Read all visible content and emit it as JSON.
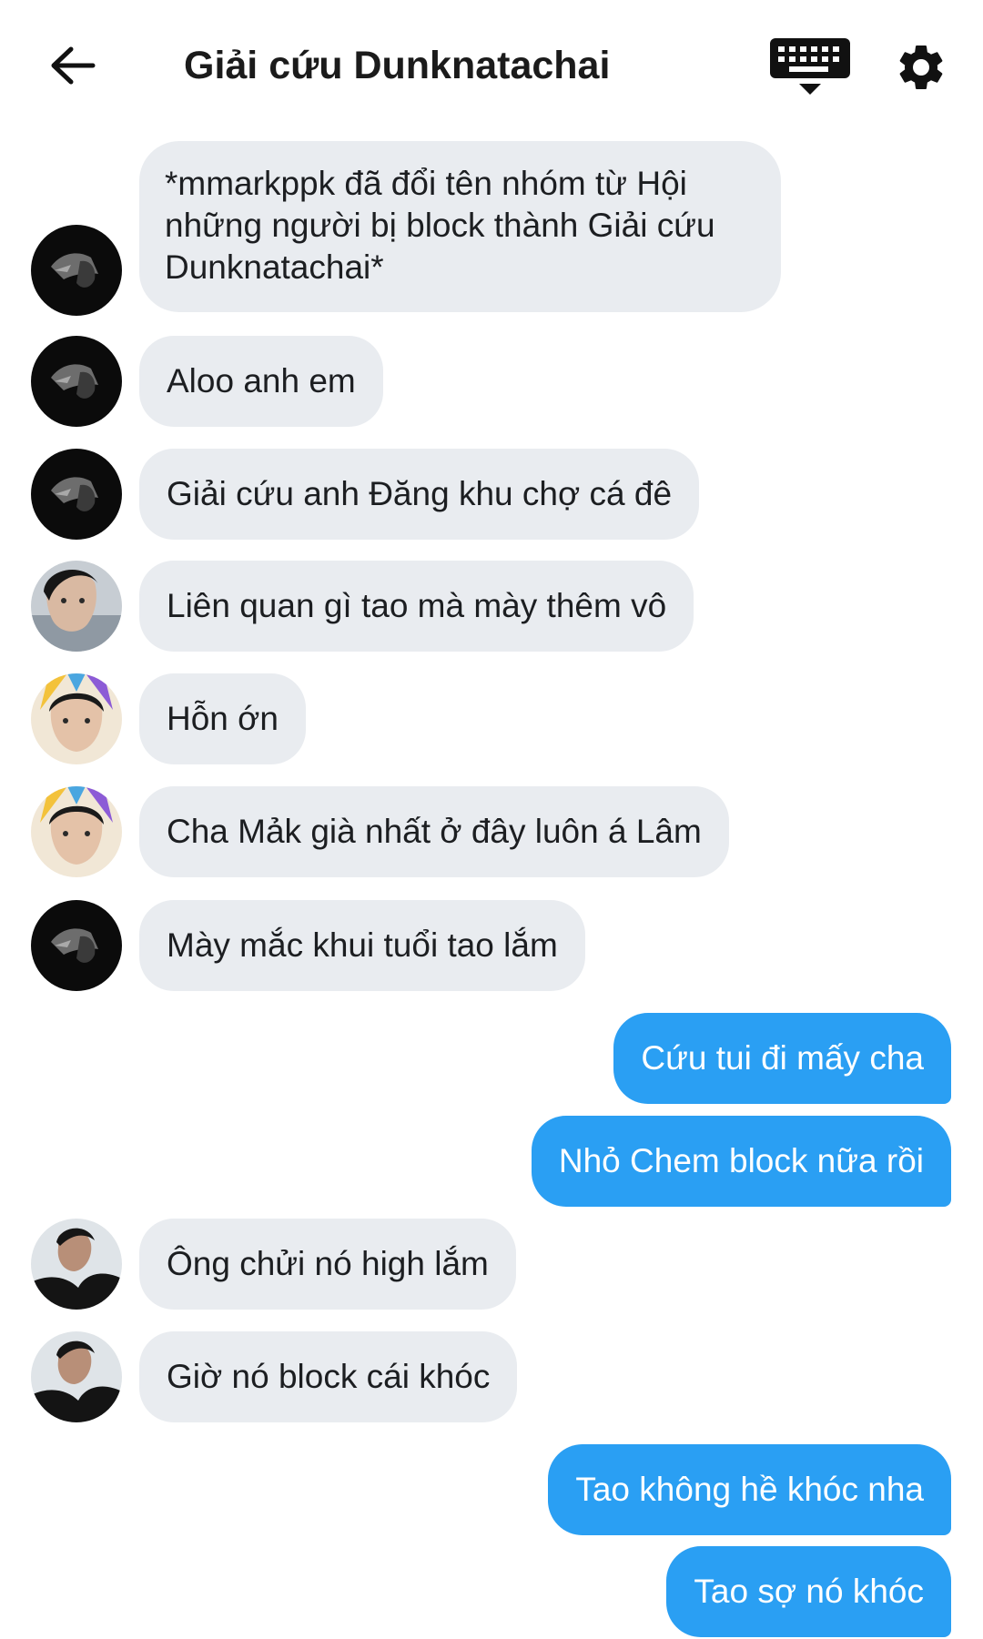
{
  "header": {
    "title": "Giải cứu Dunknatachai",
    "back_icon": "arrow-left-icon",
    "keyboard_icon": "keyboard-icon",
    "settings_icon": "gear-icon"
  },
  "messages": [
    {
      "direction": "in",
      "sender": "user-a",
      "text": "*mmarkppk đã đổi tên nhóm từ Hội những người bị block thành Giải cứu Dunknatachai*"
    },
    {
      "direction": "in",
      "sender": "user-a",
      "text": "Aloo anh em"
    },
    {
      "direction": "in",
      "sender": "user-a",
      "text": "Giải cứu anh Đăng khu chợ cá đê"
    },
    {
      "direction": "in",
      "sender": "user-b",
      "text": "Liên quan gì tao mà mày thêm vô"
    },
    {
      "direction": "in",
      "sender": "user-c",
      "text": "Hỗn ớn"
    },
    {
      "direction": "in",
      "sender": "user-c",
      "text": "Cha Mảk già nhất ở đây luôn á Lâm"
    },
    {
      "direction": "in",
      "sender": "user-a",
      "text": "Mày mắc khui tuổi tao lắm"
    },
    {
      "direction": "out",
      "text": "Cứu tui đi mấy cha"
    },
    {
      "direction": "out",
      "text": "Nhỏ Chem block nữa rồi"
    },
    {
      "direction": "in",
      "sender": "user-d",
      "text": "Ông chửi nó high lắm"
    },
    {
      "direction": "in",
      "sender": "user-d",
      "text": "Giờ nó block cái khóc"
    },
    {
      "direction": "out",
      "text": "Tao không hề khóc nha"
    },
    {
      "direction": "out",
      "text": "Tao sợ nó khóc"
    }
  ],
  "colors": {
    "incoming_bubble": "#e9ecf0",
    "outgoing_bubble": "#2a9ff3",
    "outgoing_text": "#ffffff",
    "title_text": "#1b1b1b"
  }
}
